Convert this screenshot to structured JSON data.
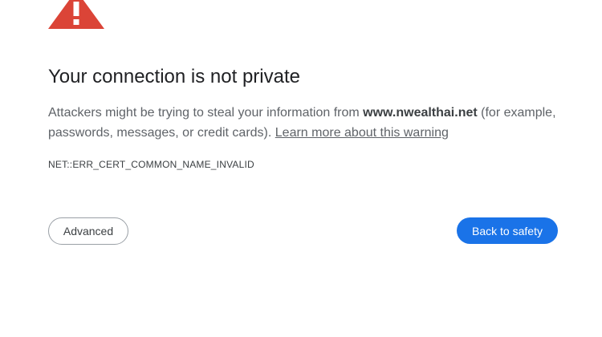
{
  "header": {
    "icon": "warning-triangle-icon",
    "title": "Your connection is not private"
  },
  "message": {
    "part1": "Attackers might be trying to steal your information from ",
    "domain": "www.nwealthai.net",
    "part2": " (for example, passwords, messages, or credit cards). ",
    "learn_more": "Learn more about this warning"
  },
  "error_code": "NET::ERR_CERT_COMMON_NAME_INVALID",
  "buttons": {
    "advanced": "Advanced",
    "back": "Back to safety"
  },
  "colors": {
    "warning_red": "#db4437",
    "primary_blue": "#1a73e8"
  }
}
